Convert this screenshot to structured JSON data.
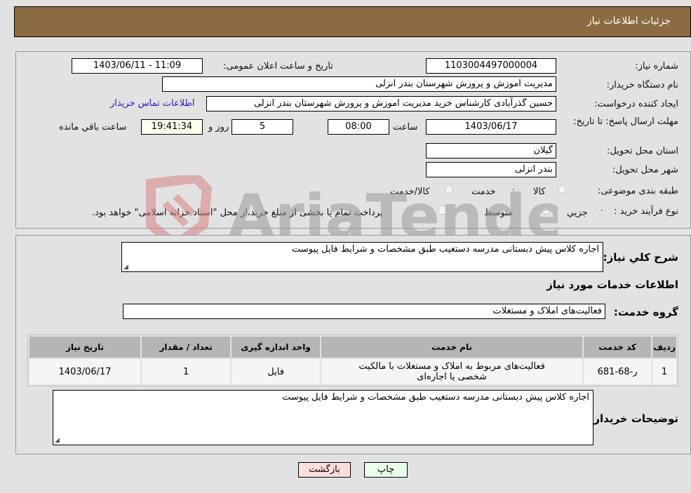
{
  "header": {
    "title": "جزئیات اطلاعات نیاز"
  },
  "form": {
    "need_number": {
      "label": "شماره نیاز:",
      "value": "1103004497000004"
    },
    "announce_datetime": {
      "label": "تاریخ و ساعت اعلان عمومی:",
      "value": "1403/06/11 - 11:09"
    },
    "buyer_org": {
      "label": "نام دستگاه خریدار:",
      "value": "مدیریت اموزش و پرورش شهرستان بندر انزلی"
    },
    "requester": {
      "label": "ایجاد کننده درخواست:",
      "value": "حسین گذرآبادی کارشناس خرید مدیریت اموزش و پرورش شهرستان بندر انزلی"
    },
    "buyer_contact_link": "اطلاعات تماس خریدار",
    "deadline": {
      "label": "مهلت ارسال پاسخ: تا تاریخ:",
      "date": "1403/06/17",
      "time_label": "ساعت",
      "time": "08:00",
      "days": "5",
      "days_label": "روز و",
      "remaining": "19:41:34",
      "remaining_label": "ساعت باقي مانده"
    },
    "province": {
      "label": "استان محل تحویل:",
      "value": "گیلان"
    },
    "city": {
      "label": "شهر محل تحویل:",
      "value": "بندر انزلی"
    },
    "category": {
      "label": "طبقه بندی موضوعی:",
      "options": [
        "کالا",
        "خدمت",
        "کالا/خدمت"
      ],
      "selected": "خدمت"
    },
    "purchase_type": {
      "label": "نوع فرآیند خرید :",
      "options": [
        "جزيي",
        "متوسط"
      ],
      "selected": "جزيي",
      "treasury_note": "پرداخت تمام یا بخشی از مبلغ خرید،از محل \"اسناد خزانه اسلامی\" خواهد بود.",
      "treasury_checked": false
    }
  },
  "description": {
    "label": "شرح كلي نياز:",
    "value": "اجاره  کلاس  پیش دبستانی  مدرسه دستغیب  طبق  مشخصات  و شرایط فایل پیوست"
  },
  "services": {
    "section_title": "اطلاعات خدمات مورد نیاز",
    "group_label": "گروه خدمت:",
    "group_value": "فعالیت‌های  املاک و مستغلات",
    "columns": [
      "ردیف",
      "کد خدمت",
      "نام خدمت",
      "واحد اندازه گیری",
      "تعداد / مقدار",
      "تاریخ نیاز"
    ],
    "rows": [
      {
        "row": "1",
        "code": "ر-68-681",
        "name": "فعالیت‌های مربوط به املاک و مستغلات با مالکیت شخصی یا اجاره‌ای",
        "unit": "فایل",
        "qty": "1",
        "date": "1403/06/17"
      }
    ]
  },
  "buyer_notes": {
    "label": "توضیحات خریدار:",
    "value": "اجاره  کلاس  پیش دبستانی  مدرسه دستغیب  طبق  مشخصات  و شرایط فایل پیوست"
  },
  "buttons": {
    "print": "چاپ",
    "back": "بازگشت"
  },
  "watermark": "AriaTender.neT",
  "colors": {
    "header": "#8b6b42",
    "print_bg": "#eaffea",
    "back_bg": "#ffdede",
    "link": "#2020c0"
  }
}
